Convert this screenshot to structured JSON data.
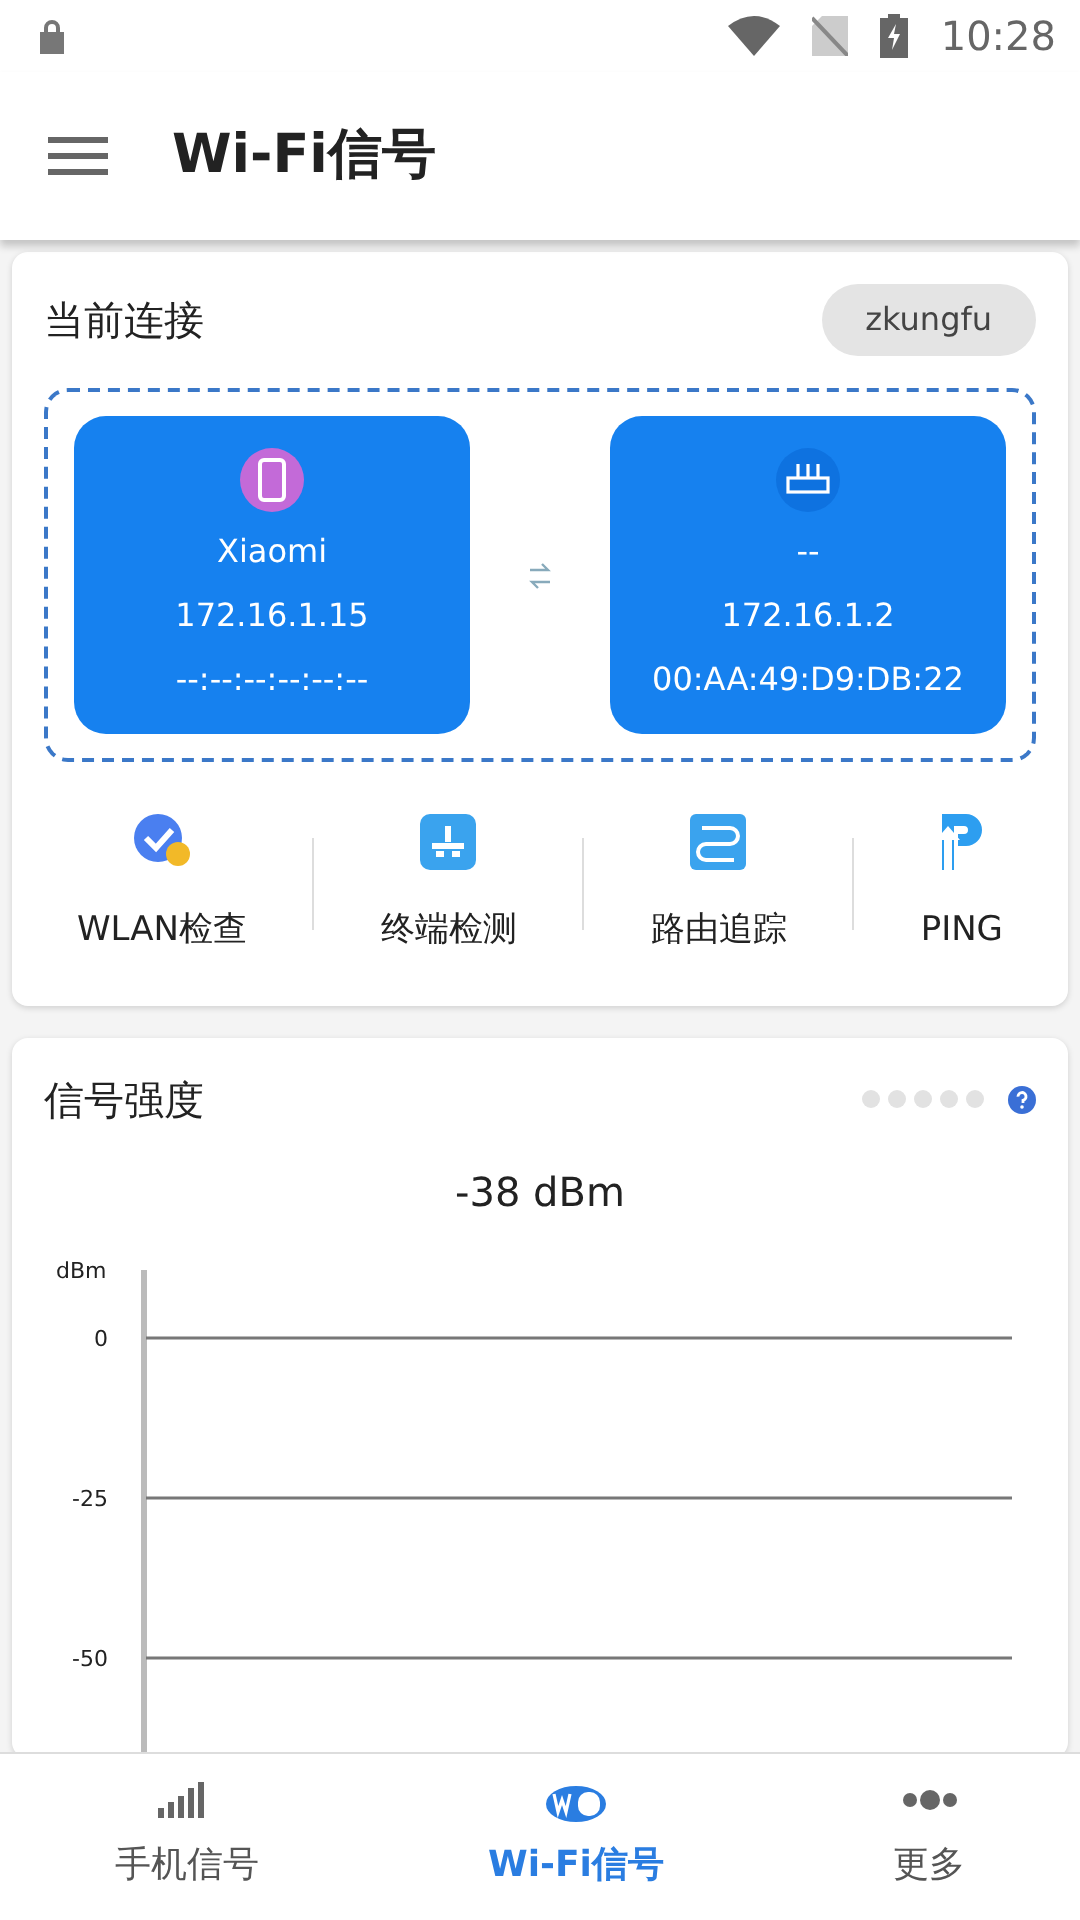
{
  "status_bar": {
    "time": "10:28"
  },
  "app_bar": {
    "title": "Wi-Fi信号"
  },
  "connection": {
    "title": "当前连接",
    "ssid": "zkungfu",
    "devices": [
      {
        "kind": "phone",
        "name": "Xiaomi",
        "ip": "172.16.1.15",
        "mac": "--:--:--:--:--:--"
      },
      {
        "kind": "router",
        "name": "--",
        "ip": "172.16.1.2",
        "mac": "00:AA:49:D9:DB:22"
      }
    ],
    "tools": [
      {
        "kind": "wlan",
        "label": "WLAN检查"
      },
      {
        "kind": "terminal",
        "label": "终端检测"
      },
      {
        "kind": "trace",
        "label": "路由追踪"
      },
      {
        "kind": "ping",
        "label": "PING"
      }
    ]
  },
  "signal": {
    "title": "信号强度",
    "reading": "-38  dBm",
    "page_dots": [
      {
        "selected": false
      },
      {
        "selected": false
      },
      {
        "selected": false
      },
      {
        "selected": false
      },
      {
        "selected": false
      }
    ],
    "graph": {
      "unit": "dBm",
      "tick_labels": [
        "0",
        "-25",
        "-50"
      ]
    }
  },
  "bottom_nav": [
    {
      "kind": "cell",
      "label": "手机信号",
      "selected": false
    },
    {
      "kind": "wifi",
      "label": "Wi-Fi信号",
      "selected": true
    },
    {
      "kind": "more",
      "label": "更多",
      "selected": false
    }
  ]
}
